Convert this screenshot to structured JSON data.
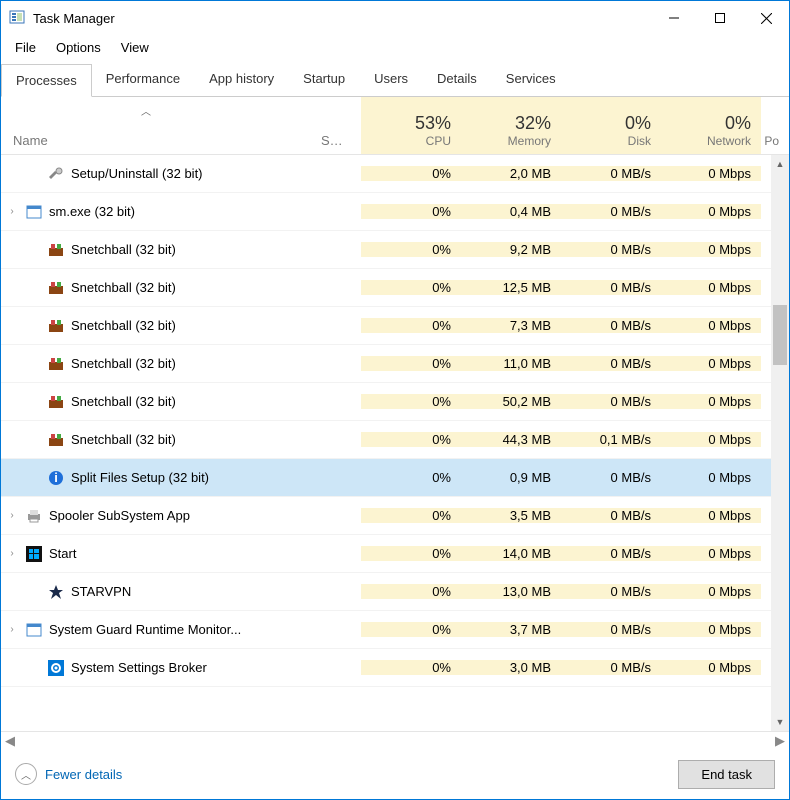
{
  "window": {
    "title": "Task Manager"
  },
  "menus": {
    "file": "File",
    "options": "Options",
    "view": "View"
  },
  "tabs": {
    "processes": "Processes",
    "performance": "Performance",
    "app_history": "App history",
    "startup": "Startup",
    "users": "Users",
    "details": "Details",
    "services": "Services"
  },
  "columns": {
    "name": "Name",
    "status": "S…",
    "cpu_pct": "53%",
    "cpu_lbl": "CPU",
    "mem_pct": "32%",
    "mem_lbl": "Memory",
    "disk_pct": "0%",
    "disk_lbl": "Disk",
    "net_pct": "0%",
    "net_lbl": "Network",
    "power_lbl": "Po"
  },
  "rows": [
    {
      "child": true,
      "icon": "wrench",
      "name": "Setup/Uninstall (32 bit)",
      "cpu": "0%",
      "mem": "2,0 MB",
      "disk": "0 MB/s",
      "net": "0 Mbps"
    },
    {
      "exp": true,
      "icon": "exe",
      "name": "sm.exe (32 bit)",
      "cpu": "0%",
      "mem": "0,4 MB",
      "disk": "0 MB/s",
      "net": "0 Mbps"
    },
    {
      "child": true,
      "icon": "game",
      "name": "Snetchball (32 bit)",
      "cpu": "0%",
      "mem": "9,2 MB",
      "disk": "0 MB/s",
      "net": "0 Mbps"
    },
    {
      "child": true,
      "icon": "game",
      "name": "Snetchball (32 bit)",
      "cpu": "0%",
      "mem": "12,5 MB",
      "disk": "0 MB/s",
      "net": "0 Mbps"
    },
    {
      "child": true,
      "icon": "game",
      "name": "Snetchball (32 bit)",
      "cpu": "0%",
      "mem": "7,3 MB",
      "disk": "0 MB/s",
      "net": "0 Mbps"
    },
    {
      "child": true,
      "icon": "game",
      "name": "Snetchball (32 bit)",
      "cpu": "0%",
      "mem": "11,0 MB",
      "disk": "0 MB/s",
      "net": "0 Mbps"
    },
    {
      "child": true,
      "icon": "game",
      "name": "Snetchball (32 bit)",
      "cpu": "0%",
      "mem": "50,2 MB",
      "disk": "0 MB/s",
      "net": "0 Mbps"
    },
    {
      "child": true,
      "icon": "game",
      "name": "Snetchball (32 bit)",
      "cpu": "0%",
      "mem": "44,3 MB",
      "disk": "0,1 MB/s",
      "net": "0 Mbps"
    },
    {
      "child": true,
      "selected": true,
      "icon": "info",
      "name": "Split Files Setup (32 bit)",
      "cpu": "0%",
      "mem": "0,9 MB",
      "disk": "0 MB/s",
      "net": "0 Mbps"
    },
    {
      "exp": true,
      "icon": "printer",
      "name": "Spooler SubSystem App",
      "cpu": "0%",
      "mem": "3,5 MB",
      "disk": "0 MB/s",
      "net": "0 Mbps"
    },
    {
      "exp": true,
      "icon": "start",
      "name": "Start",
      "cpu": "0%",
      "mem": "14,0 MB",
      "disk": "0 MB/s",
      "net": "0 Mbps"
    },
    {
      "child": true,
      "icon": "star",
      "name": "STARVPN",
      "cpu": "0%",
      "mem": "13,0 MB",
      "disk": "0 MB/s",
      "net": "0 Mbps"
    },
    {
      "exp": true,
      "icon": "exe",
      "name": "System Guard Runtime Monitor...",
      "cpu": "0%",
      "mem": "3,7 MB",
      "disk": "0 MB/s",
      "net": "0 Mbps"
    },
    {
      "child": true,
      "icon": "gear",
      "name": "System Settings Broker",
      "cpu": "0%",
      "mem": "3,0 MB",
      "disk": "0 MB/s",
      "net": "0 Mbps"
    }
  ],
  "footer": {
    "fewer": "Fewer details",
    "endtask": "End task"
  }
}
